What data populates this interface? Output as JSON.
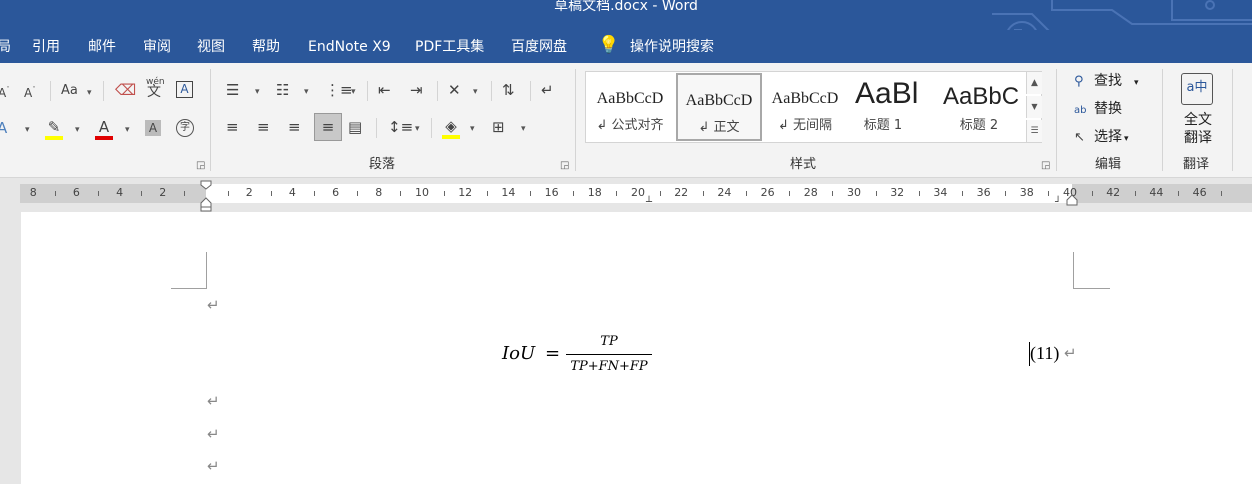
{
  "title": "草稿文档.docx  -  Word",
  "tabs": {
    "t0": "局",
    "t1": "引用",
    "t2": "邮件",
    "t3": "审阅",
    "t4": "视图",
    "t5": "帮助",
    "t6": "EndNote X9",
    "t7": "PDF工具集",
    "t8": "百度网盘",
    "t9": "操作说明搜索"
  },
  "ribbon": {
    "font_case": "Aa",
    "phonetic_top": "wén",
    "phonetic_main": "文",
    "paragraph_label": "段落",
    "styles_label": "样式",
    "editing_label": "编辑",
    "translate_label": "翻译",
    "find": "查找",
    "replace": "替换",
    "select": "选择",
    "full_translate_1": "全文",
    "full_translate_2": "翻译",
    "styles": {
      "s0": {
        "sample": "AaBbCcD",
        "name": "公式对齐"
      },
      "s1": {
        "sample": "AaBbCcD",
        "name": "正文"
      },
      "s2": {
        "sample": "AaBbCcD",
        "name": "无间隔"
      },
      "s3": {
        "sample": "AaBl",
        "name": "标题 1"
      },
      "s4": {
        "sample": "AaBbC",
        "name": "标题 2"
      }
    }
  },
  "ruler": {
    "labels": [
      "8",
      "6",
      "4",
      "2",
      "2",
      "4",
      "6",
      "8",
      "10",
      "12",
      "14",
      "16",
      "18",
      "20",
      "22",
      "24",
      "26",
      "28",
      "30",
      "32",
      "34",
      "36",
      "38",
      "40",
      "42",
      "44",
      "46"
    ]
  },
  "equation": {
    "lhs": "IoU",
    "equals": "=",
    "numerator": "TP",
    "denominator": "TP+FN+FP",
    "number": "(11)"
  },
  "paragraph_mark": "↵",
  "colors": {
    "accent": "#2b579a",
    "highlight": "#ffff00",
    "font_color": "#e00000",
    "ribbon_bg": "#f3f3f3"
  }
}
